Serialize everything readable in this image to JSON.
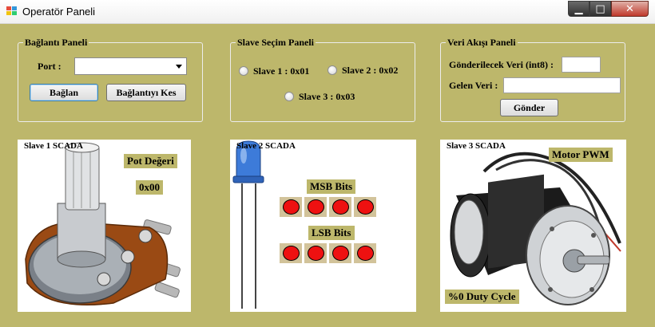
{
  "window": {
    "title": "Operatör Paneli",
    "controls": {
      "minimize": "▁",
      "maximize": "□",
      "close": "✕"
    }
  },
  "connection_panel": {
    "title": "Bağlantı Paneli",
    "port_label": "Port :",
    "port_value": "",
    "connect_button": "Bağlan",
    "disconnect_button": "Bağlantıyı Kes"
  },
  "slave_panel": {
    "title": "Slave Seçim Paneli",
    "options": [
      "Slave 1 : 0x01",
      "Slave 2 : 0x02",
      "Slave 3 : 0x03"
    ]
  },
  "data_panel": {
    "title": "Veri Akışı Paneli",
    "send_label": "Gönderilecek Veri (int8) :",
    "send_value": "",
    "receive_label": "Gelen Veri :",
    "receive_value": "",
    "send_button": "Gönder"
  },
  "scada1": {
    "title": "Slave 1 SCADA",
    "pot_label": "Pot Değeri",
    "pot_value": "0x00"
  },
  "scada2": {
    "title": "Slave 2 SCADA",
    "msb_label": "MSB Bits",
    "lsb_label": "LSB Bits"
  },
  "scada3": {
    "title": "Slave 3 SCADA",
    "motor_label": "Motor PWM",
    "duty_label": "%0 Duty Cycle"
  },
  "colors": {
    "background": "#bdb76b",
    "led_red": "#ee1111",
    "bit_frame": "#d2c39a"
  },
  "icons": [
    "app-icon",
    "potentiometer-image",
    "blue-led-image",
    "dc-motor-image"
  ]
}
